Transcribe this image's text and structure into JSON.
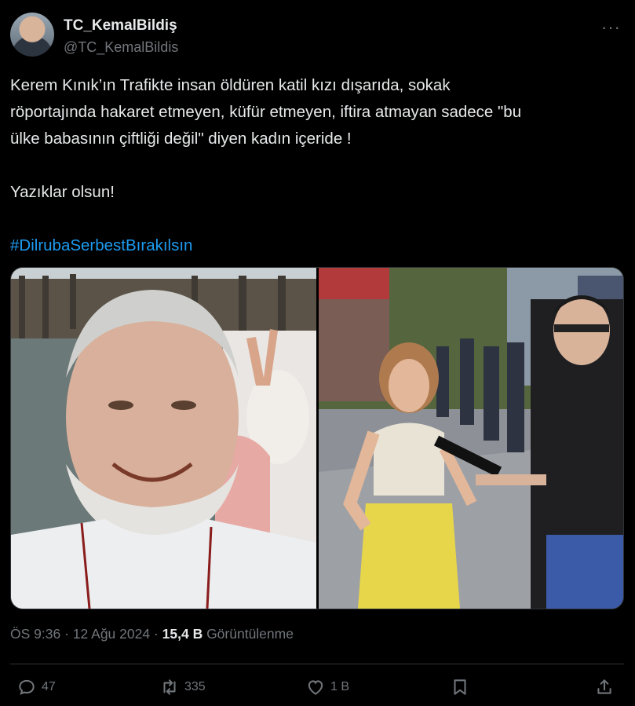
{
  "author": {
    "display_name": "TC_KemalBildiş",
    "handle": "@TC_KemalBildis",
    "more_icon": "more-horizontal-icon"
  },
  "tweet": {
    "line1": "Kerem Kınık’ın Trafikte  insan öldüren katil kızı dışarıda, sokak",
    "line2": "röportajında hakaret etmeyen, küfür etmeyen, iftira atmayan sadece \"bu",
    "line3": "ülke babasının çiftliği değil\" diyen kadın içeride !",
    "line4": "Yazıklar olsun!",
    "hashtag": "#DilrubaSerbestBırakılsın"
  },
  "meta": {
    "time": "ÖS 9:36",
    "dot1": " · ",
    "date": "12 Ağu 2024",
    "dot2": " · ",
    "views_count": "15,4 B",
    "views_label": " Görüntülenme"
  },
  "actions": {
    "reply_count": "47",
    "retweet_count": "335",
    "like_count": "1 B"
  },
  "colors": {
    "background": "#000000",
    "text": "#e7e9ea",
    "secondary": "#71767b",
    "link": "#1d9bf0",
    "border": "#2f3336"
  }
}
